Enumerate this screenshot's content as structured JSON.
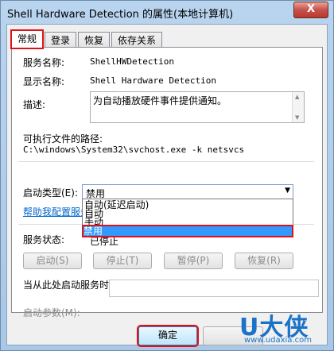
{
  "window": {
    "title": "Shell Hardware Detection 的属性(本地计算机)",
    "close_glyph": "X"
  },
  "tabs": [
    {
      "label": "常规",
      "active": true
    },
    {
      "label": "登录",
      "active": false
    },
    {
      "label": "恢复",
      "active": false
    },
    {
      "label": "依存关系",
      "active": false
    }
  ],
  "general": {
    "service_name_label": "服务名称:",
    "service_name": "ShellHWDetection",
    "display_name_label": "显示名称:",
    "display_name": "Shell Hardware Detection",
    "description_label": "描述:",
    "description": "为自动播放硬件事件提供通知。",
    "exe_path_label": "可执行文件的路径:",
    "exe_path": "C:\\windows\\System32\\svchost.exe -k netsvcs",
    "startup_type_label": "启动类型(E):",
    "startup_type_value": "禁用",
    "startup_options": [
      "自动(延迟启动)",
      "自动",
      "手动",
      "禁用"
    ],
    "help_link": "帮助我配置服务启",
    "service_status_label": "服务状态:",
    "service_status": "已停止",
    "buttons": {
      "start": "启动(S)",
      "stop": "停止(T)",
      "pause": "暂停(P)",
      "resume": "恢复(R)"
    },
    "hint": "当从此处启动服务时，您可指定所适用的启动参数。",
    "start_params_label": "启动参数(M):",
    "start_params_value": ""
  },
  "footer": {
    "ok": "确定"
  },
  "watermark": {
    "big": "U大侠",
    "small": "www.udaxia.com"
  },
  "colors": {
    "highlight": "#e0101a",
    "selection": "#3399ff",
    "link": "#0066cc"
  }
}
